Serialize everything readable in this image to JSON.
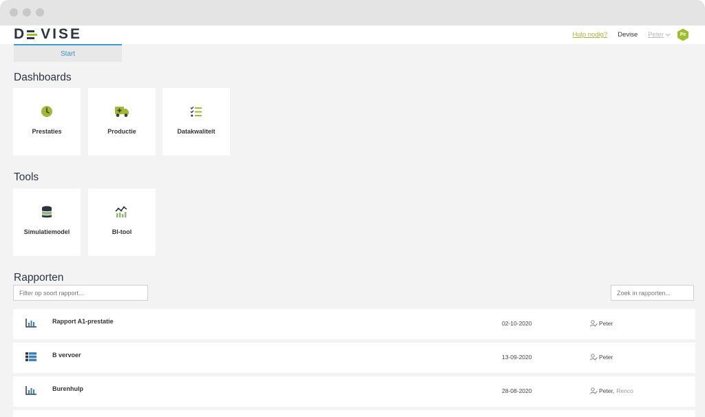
{
  "brand": {
    "logo_left": "D",
    "logo_right": "VISE"
  },
  "header": {
    "help_link": "Hulp nodig?",
    "company": "Devise",
    "user": "Peter",
    "avatar_initials": "Pe",
    "accent_color": "#9fbe2f"
  },
  "tabs": [
    {
      "label": "Start"
    }
  ],
  "sections": {
    "dashboards": {
      "title": "Dashboards",
      "items": [
        {
          "label": "Prestaties",
          "icon": "clock-icon"
        },
        {
          "label": "Productie",
          "icon": "ambulance-icon"
        },
        {
          "label": "Datakwaliteit",
          "icon": "checklist-icon"
        }
      ]
    },
    "tools": {
      "title": "Tools",
      "items": [
        {
          "label": "Simulatiemodel",
          "icon": "database-icon"
        },
        {
          "label": "BI-tool",
          "icon": "trend-chart-icon"
        }
      ]
    },
    "reports": {
      "title": "Rapporten",
      "filter_placeholder": "Filter op soort rapport...",
      "search_placeholder": "Zoek in rapporten...",
      "rows": [
        {
          "name": "Rapport A1-prestatie",
          "date": "02-10-2020",
          "owner": "Peter",
          "shared": "",
          "icon": "bar-chart-icon"
        },
        {
          "name": "B vervoer",
          "date": "13-09-2020",
          "owner": "Peter",
          "shared": "",
          "icon": "table-icon"
        },
        {
          "name": "Burenhulp",
          "date": "28-08-2020",
          "owner": "Peter,",
          "shared": "Renco",
          "icon": "bar-chart-icon"
        }
      ]
    }
  }
}
